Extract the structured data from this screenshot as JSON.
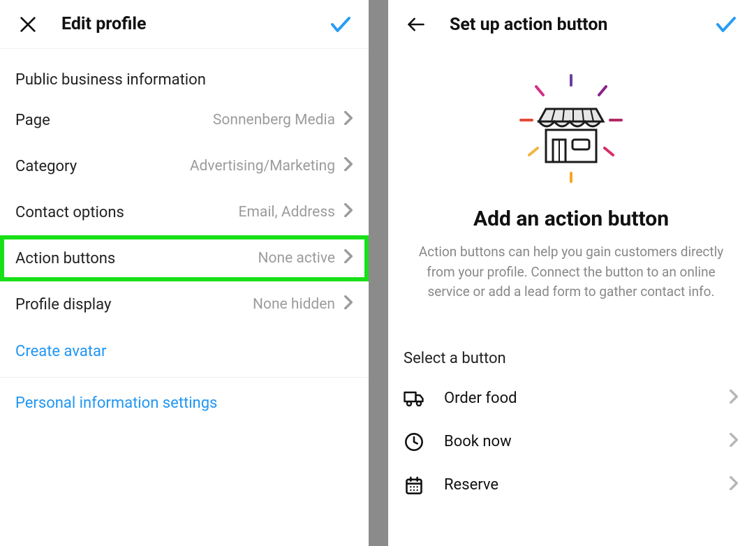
{
  "left": {
    "header": {
      "title": "Edit profile"
    },
    "section_label": "Public business information",
    "rows": [
      {
        "label": "Page",
        "value": "Sonnenberg Media"
      },
      {
        "label": "Category",
        "value": "Advertising/Marketing"
      },
      {
        "label": "Contact options",
        "value": "Email, Address"
      },
      {
        "label": "Action buttons",
        "value": "None active"
      },
      {
        "label": "Profile display",
        "value": "None hidden"
      }
    ],
    "links": {
      "create_avatar": "Create avatar",
      "personal_info": "Personal information settings"
    }
  },
  "right": {
    "header": {
      "title": "Set up action button"
    },
    "hero": {
      "heading": "Add an action button",
      "body": "Action buttons can help you gain customers directly from your profile. Connect the button to an online service or add a lead form to gather contact info."
    },
    "select_label": "Select a button",
    "options": [
      {
        "label": "Order food"
      },
      {
        "label": "Book now"
      },
      {
        "label": "Reserve"
      }
    ]
  },
  "colors": {
    "accent": "#289cf3",
    "highlight": "#18e018"
  }
}
